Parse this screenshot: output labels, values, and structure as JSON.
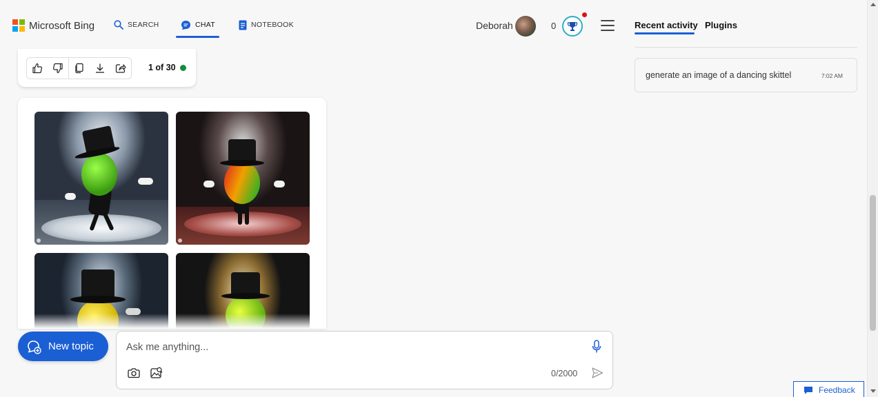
{
  "header": {
    "brand": "Microsoft Bing",
    "nav": [
      {
        "label": "SEARCH",
        "icon": "search-icon"
      },
      {
        "label": "CHAT",
        "icon": "chat-icon",
        "active": true
      },
      {
        "label": "NOTEBOOK",
        "icon": "notebook-icon"
      }
    ],
    "user_name": "Deborah",
    "rewards_count": "0",
    "accent_color": "#1b5fd4"
  },
  "right_panel": {
    "tabs": [
      {
        "label": "Recent activity",
        "active": true
      },
      {
        "label": "Plugins",
        "active": false
      }
    ],
    "activity": [
      {
        "title": "generate an image of a dancing skittel",
        "time": "7:02 AM"
      }
    ]
  },
  "response_actions": {
    "buttons": [
      "like-icon",
      "dislike-icon",
      "copy-icon",
      "download-icon",
      "share-icon"
    ],
    "pager": "1 of 30",
    "status_color": "#128c3a"
  },
  "images": {
    "count": 4,
    "subject": "dancing candy character in top hat on stage"
  },
  "composer": {
    "new_topic_label": "New topic",
    "placeholder": "Ask me anything...",
    "char_count": "0/2000"
  },
  "feedback_label": "Feedback"
}
